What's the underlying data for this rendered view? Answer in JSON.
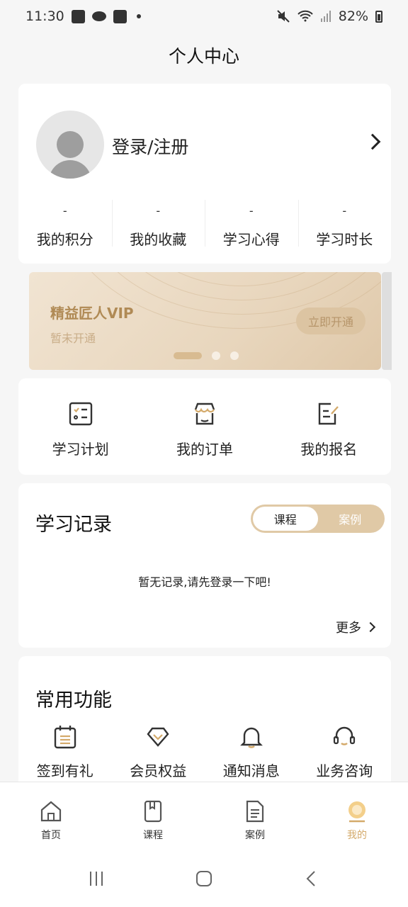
{
  "status_bar": {
    "time": "11:30",
    "battery": "82%"
  },
  "page": {
    "title": "个人中心"
  },
  "profile": {
    "login_label": "登录/注册",
    "stats": [
      {
        "value": "-",
        "label": "我的积分"
      },
      {
        "value": "-",
        "label": "我的收藏"
      },
      {
        "value": "-",
        "label": "学习心得"
      },
      {
        "value": "-",
        "label": "学习时长"
      }
    ]
  },
  "vip": {
    "title": "精益匠人VIP",
    "subtitle": "暂未开通",
    "button": "立即开通",
    "active_slide": 1,
    "slide_count": 3
  },
  "shortcuts": [
    {
      "icon": "checklist-icon",
      "label": "学习计划"
    },
    {
      "icon": "store-icon",
      "label": "我的订单"
    },
    {
      "icon": "edit-document-icon",
      "label": "我的报名"
    }
  ],
  "records": {
    "title": "学习记录",
    "tabs": [
      "课程",
      "案例"
    ],
    "active_tab": "课程",
    "empty_message": "暂无记录,请先登录一下吧!",
    "more_label": "更多"
  },
  "functions": {
    "title": "常用功能",
    "items": [
      {
        "icon": "calendar-icon",
        "label": "签到有礼"
      },
      {
        "icon": "diamond-icon",
        "label": "会员权益"
      },
      {
        "icon": "bell-icon",
        "label": "通知消息"
      },
      {
        "icon": "headset-icon",
        "label": "业务咨询"
      }
    ]
  },
  "tabbar": {
    "items": [
      {
        "icon": "home-icon",
        "label": "首页"
      },
      {
        "icon": "book-icon",
        "label": "课程"
      },
      {
        "icon": "document-icon",
        "label": "案例"
      },
      {
        "icon": "profile-icon",
        "label": "我的"
      }
    ],
    "active": "我的"
  },
  "colors": {
    "accent": "#d4aa6b",
    "vip_text": "#b08a55",
    "background": "#f6f6f6"
  }
}
